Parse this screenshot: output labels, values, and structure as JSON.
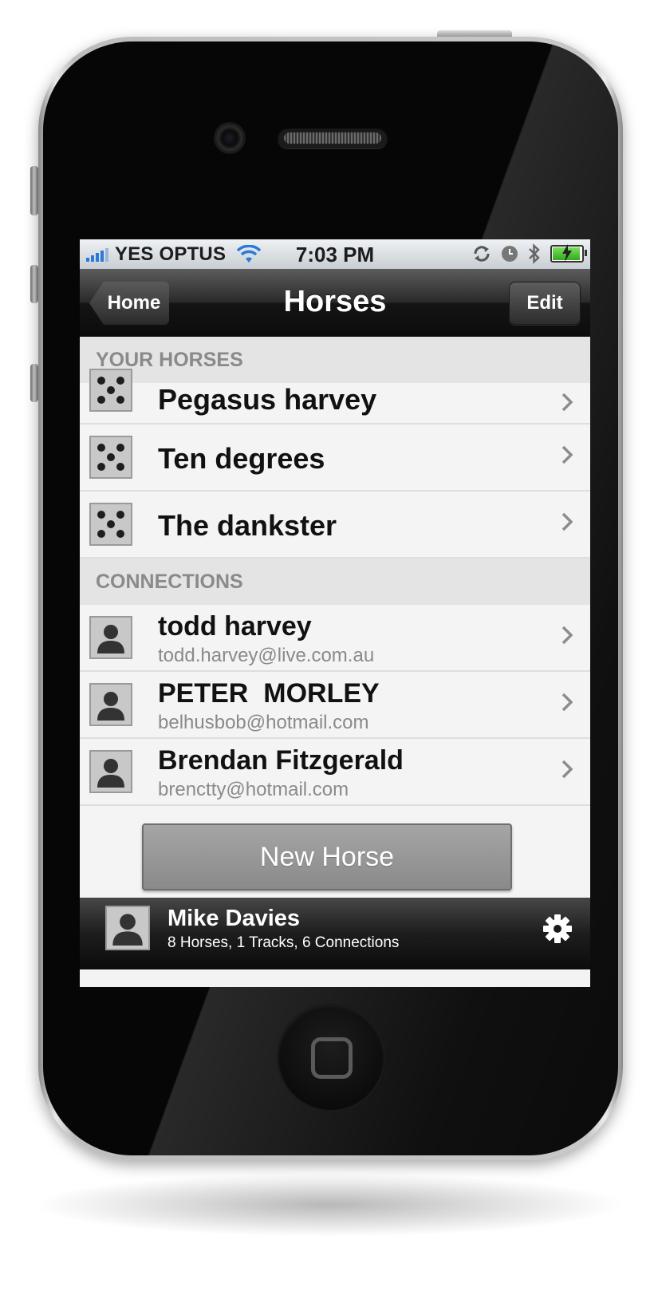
{
  "status_bar": {
    "carrier": "YES OPTUS",
    "time": "7:03 PM"
  },
  "nav_bar": {
    "title": "Horses",
    "back_label": "Home",
    "edit_label": "Edit"
  },
  "sections": {
    "horses_header": "YOUR HORSES",
    "horses": [
      {
        "name": "Pegasus harvey"
      },
      {
        "name": "Ten degrees"
      },
      {
        "name": "The dankster"
      }
    ],
    "connections_header": "CONNECTIONS",
    "connections": [
      {
        "name": "todd harvey",
        "email": "todd.harvey@live.com.au"
      },
      {
        "name": "PETER  MORLEY",
        "email": "belhusbob@hotmail.com"
      },
      {
        "name": "Brendan Fitzgerald",
        "email": "brenctty@hotmail.com"
      }
    ]
  },
  "actions": {
    "new_horse_label": "New Horse"
  },
  "footer": {
    "user_name": "Mike Davies",
    "stats": "8 Horses, 1 Tracks, 6 Connections"
  },
  "icons": {
    "signal": "signal-bars-icon",
    "wifi": "wifi-icon",
    "sync": "sync-icon",
    "alarm": "clock-icon",
    "bluetooth": "bluetooth-icon",
    "battery": "battery-charging-icon",
    "horse_thumb": "dice-placeholder-icon",
    "person": "person-silhouette-icon",
    "chevron": "chevron-right-icon",
    "settings": "gear-icon"
  },
  "colors": {
    "signal_blue": "#2a7ad8",
    "battery_green": "#33a81c",
    "section_header_text": "#8a8a8a",
    "button_gray": "#8a8a8a"
  }
}
